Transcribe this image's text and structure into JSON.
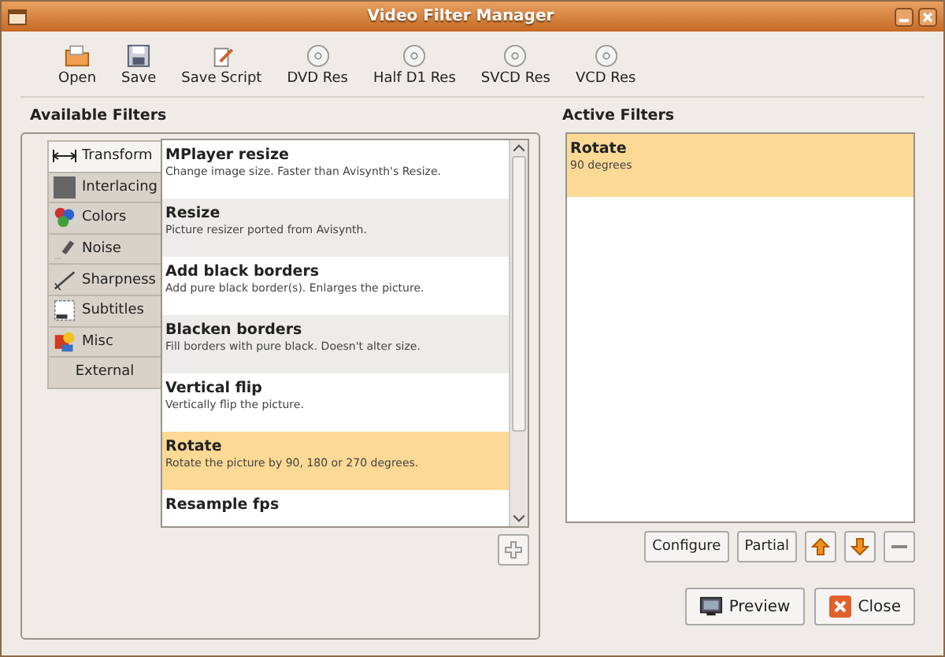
{
  "window": {
    "title": "Video Filter Manager"
  },
  "toolbar": [
    {
      "label": "Open",
      "kind": "open"
    },
    {
      "label": "Save",
      "kind": "save"
    },
    {
      "label": "Save Script",
      "kind": "script"
    },
    {
      "label": "DVD Res",
      "kind": "disc"
    },
    {
      "label": "Half D1 Res",
      "kind": "disc"
    },
    {
      "label": "SVCD Res",
      "kind": "disc"
    },
    {
      "label": "VCD Res",
      "kind": "disc"
    }
  ],
  "available": {
    "heading": "Available Filters",
    "categories": [
      {
        "label": "Transform",
        "kind": "transform",
        "selected": true
      },
      {
        "label": "Interlacing",
        "kind": "interlacing",
        "selected": false
      },
      {
        "label": "Colors",
        "kind": "colors",
        "selected": false
      },
      {
        "label": "Noise",
        "kind": "noise",
        "selected": false
      },
      {
        "label": "Sharpness",
        "kind": "sharpness",
        "selected": false
      },
      {
        "label": "Subtitles",
        "kind": "subtitles",
        "selected": false
      },
      {
        "label": "Misc",
        "kind": "misc",
        "selected": false
      },
      {
        "label": "External",
        "kind": "none",
        "selected": false
      }
    ],
    "filters": [
      {
        "name": "MPlayer resize",
        "description": "Change image size. Faster than Avisynth's Resize.",
        "selected": false
      },
      {
        "name": "Resize",
        "description": "Picture resizer ported from Avisynth.",
        "selected": false
      },
      {
        "name": "Add black borders",
        "description": "Add pure black border(s). Enlarges the picture.",
        "selected": false
      },
      {
        "name": "Blacken borders",
        "description": "Fill borders with pure black. Doesn't alter size.",
        "selected": false
      },
      {
        "name": "Vertical flip",
        "description": "Vertically flip the picture.",
        "selected": false
      },
      {
        "name": "Rotate",
        "description": "Rotate the picture by 90, 180 or 270 degrees.",
        "selected": true
      },
      {
        "name": "Resample fps",
        "selected": false
      }
    ]
  },
  "active": {
    "heading": "Active Filters",
    "filters": [
      {
        "name": "Rotate",
        "description": "90 degrees",
        "selected": true
      }
    ],
    "buttons": [
      {
        "label": "Configure",
        "kind": "text"
      },
      {
        "label": "Partial",
        "kind": "text"
      },
      {
        "kind": "up"
      },
      {
        "kind": "down"
      },
      {
        "kind": "remove"
      }
    ]
  },
  "footer": [
    {
      "label": "Preview",
      "kind": "preview"
    },
    {
      "label": "Close",
      "kind": "close"
    }
  ]
}
